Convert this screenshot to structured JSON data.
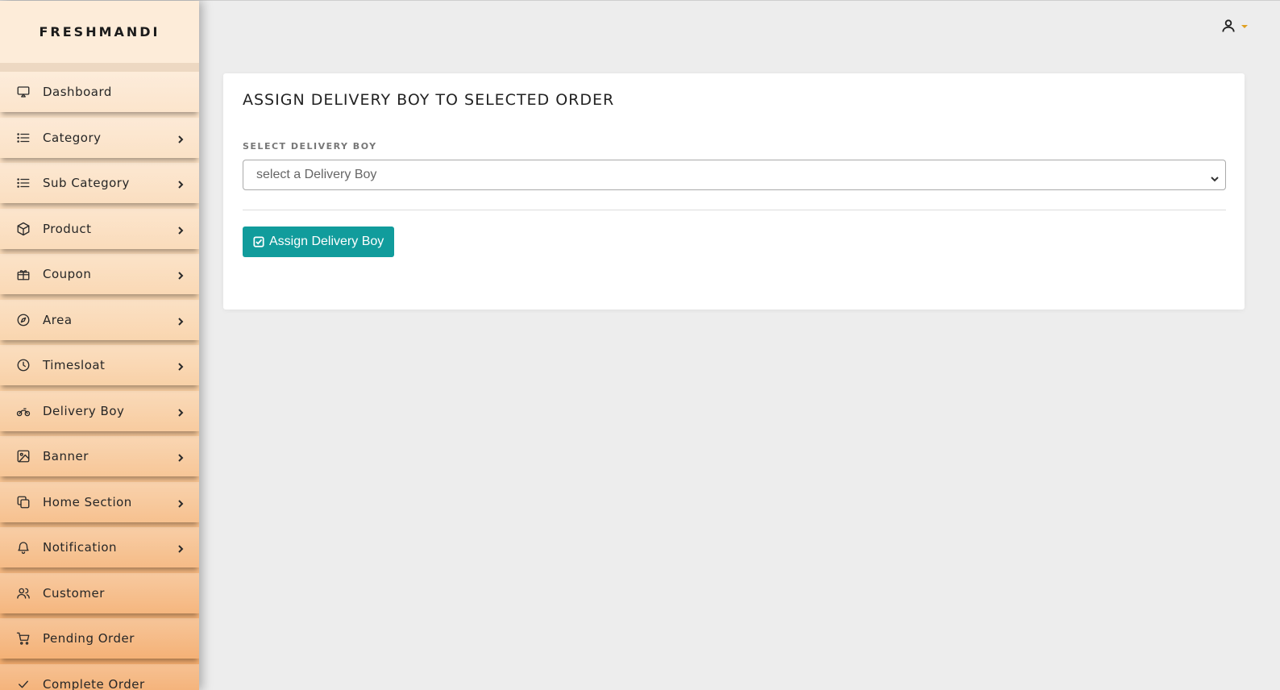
{
  "brand": "FRESHMANDI",
  "sidebar": {
    "items": [
      {
        "label": "Dashboard",
        "icon": "monitor-icon",
        "has_chevron": false
      },
      {
        "label": "Category",
        "icon": "list-icon",
        "has_chevron": true
      },
      {
        "label": "Sub Category",
        "icon": "list-icon",
        "has_chevron": true
      },
      {
        "label": "Product",
        "icon": "package-icon",
        "has_chevron": true
      },
      {
        "label": "Coupon",
        "icon": "gift-icon",
        "has_chevron": true
      },
      {
        "label": "Area",
        "icon": "compass-icon",
        "has_chevron": true
      },
      {
        "label": "Timesloat",
        "icon": "clock-icon",
        "has_chevron": true
      },
      {
        "label": "Delivery Boy",
        "icon": "motorcycle-icon",
        "has_chevron": true
      },
      {
        "label": "Banner",
        "icon": "image-icon",
        "has_chevron": true
      },
      {
        "label": "Home Section",
        "icon": "copy-icon",
        "has_chevron": true
      },
      {
        "label": "Notification",
        "icon": "bell-icon",
        "has_chevron": true
      },
      {
        "label": "Customer",
        "icon": "users-icon",
        "has_chevron": false
      },
      {
        "label": "Pending Order",
        "icon": "cart-icon",
        "has_chevron": false
      },
      {
        "label": "Complete Order",
        "icon": "check-icon",
        "has_chevron": false
      }
    ]
  },
  "header": {
    "user_icon": "user-icon"
  },
  "main": {
    "title": "ASSIGN DELIVERY BOY TO SELECTED ORDER",
    "field_label": "SELECT DELIVERY BOY",
    "select_value": "select a Delivery Boy",
    "assign_button": "Assign Delivery Boy"
  },
  "colors": {
    "accent": "#119c9c",
    "caret": "#e0a020",
    "sidebar_top": "#fdebd8",
    "sidebar_bottom": "#f3a969"
  }
}
